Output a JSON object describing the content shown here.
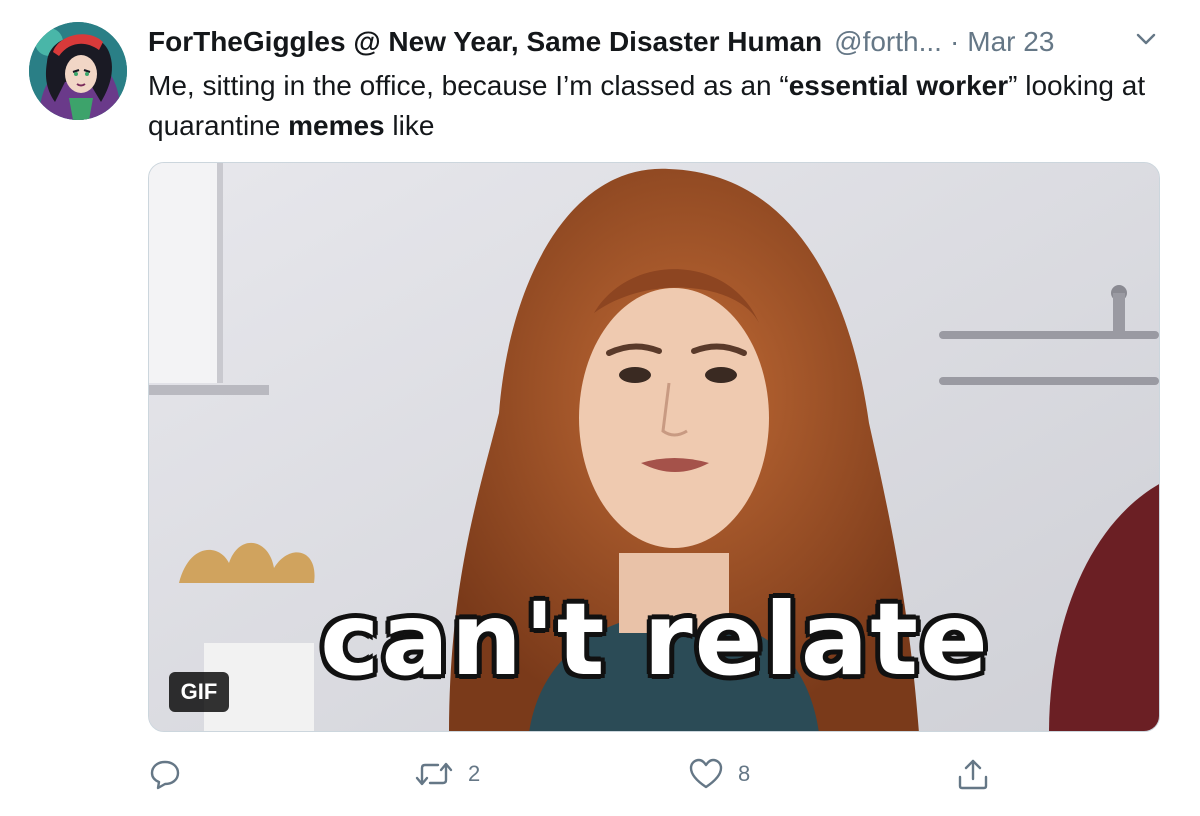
{
  "tweet": {
    "name": "ForTheGiggles @ New Year, Same Disaster Human",
    "handle": "@forth...",
    "separator": "·",
    "date": "Mar 23",
    "text": {
      "part1": "Me, sitting in the office, because I’m classed as an “",
      "bold1": "essential worker",
      "part2": "” looking at quarantine ",
      "bold2": "memes",
      "part3": " like"
    }
  },
  "media": {
    "badge": "GIF",
    "caption": "can't relate"
  },
  "actions": {
    "reply_icon": "reply-icon",
    "retweet_icon": "retweet-icon",
    "retweet_count": "2",
    "like_icon": "heart-icon",
    "like_count": "8",
    "share_icon": "share-icon"
  },
  "colors": {
    "text_primary": "#14171a",
    "text_secondary": "#657786",
    "border": "#ccd6dd"
  }
}
